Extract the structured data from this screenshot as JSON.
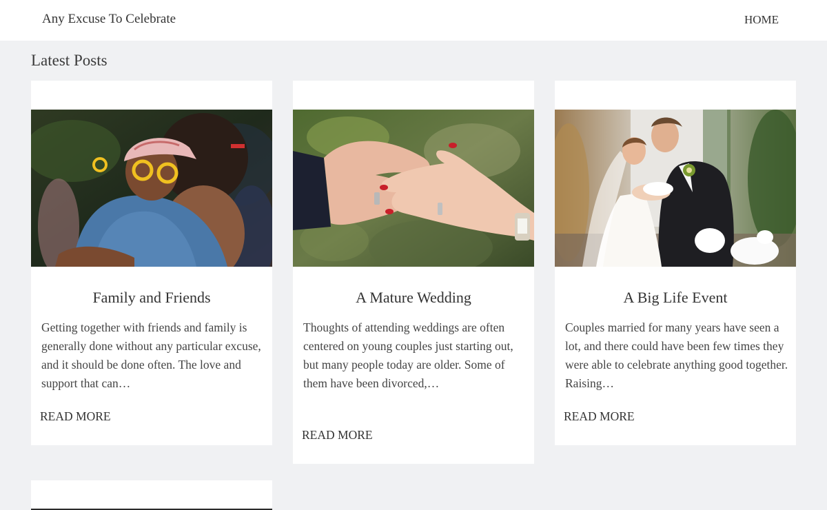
{
  "header": {
    "site_title": "Any Excuse To Celebrate",
    "nav_home": "HOME"
  },
  "main": {
    "section_title": "Latest Posts",
    "posts": [
      {
        "title": "Family and Friends",
        "excerpt": "Getting together with friends and family is generally done without any particular excuse, and it should be done often. The love and support that can…",
        "read_more": "READ MORE"
      },
      {
        "title": "A Mature Wedding",
        "excerpt": "Thoughts of attending weddings are often centered on young couples just starting out, but many people today are older. Some of them have been divorced,…",
        "read_more": "READ MORE"
      },
      {
        "title": "A Big Life Event",
        "excerpt": "Couples married for many years have seen a lot, and there could have been few times they were able to celebrate anything good together. Raising…",
        "read_more": "READ MORE"
      }
    ]
  },
  "colors": {
    "page_background": "#f0f1f3",
    "card_background": "#ffffff",
    "text": "#333333"
  }
}
